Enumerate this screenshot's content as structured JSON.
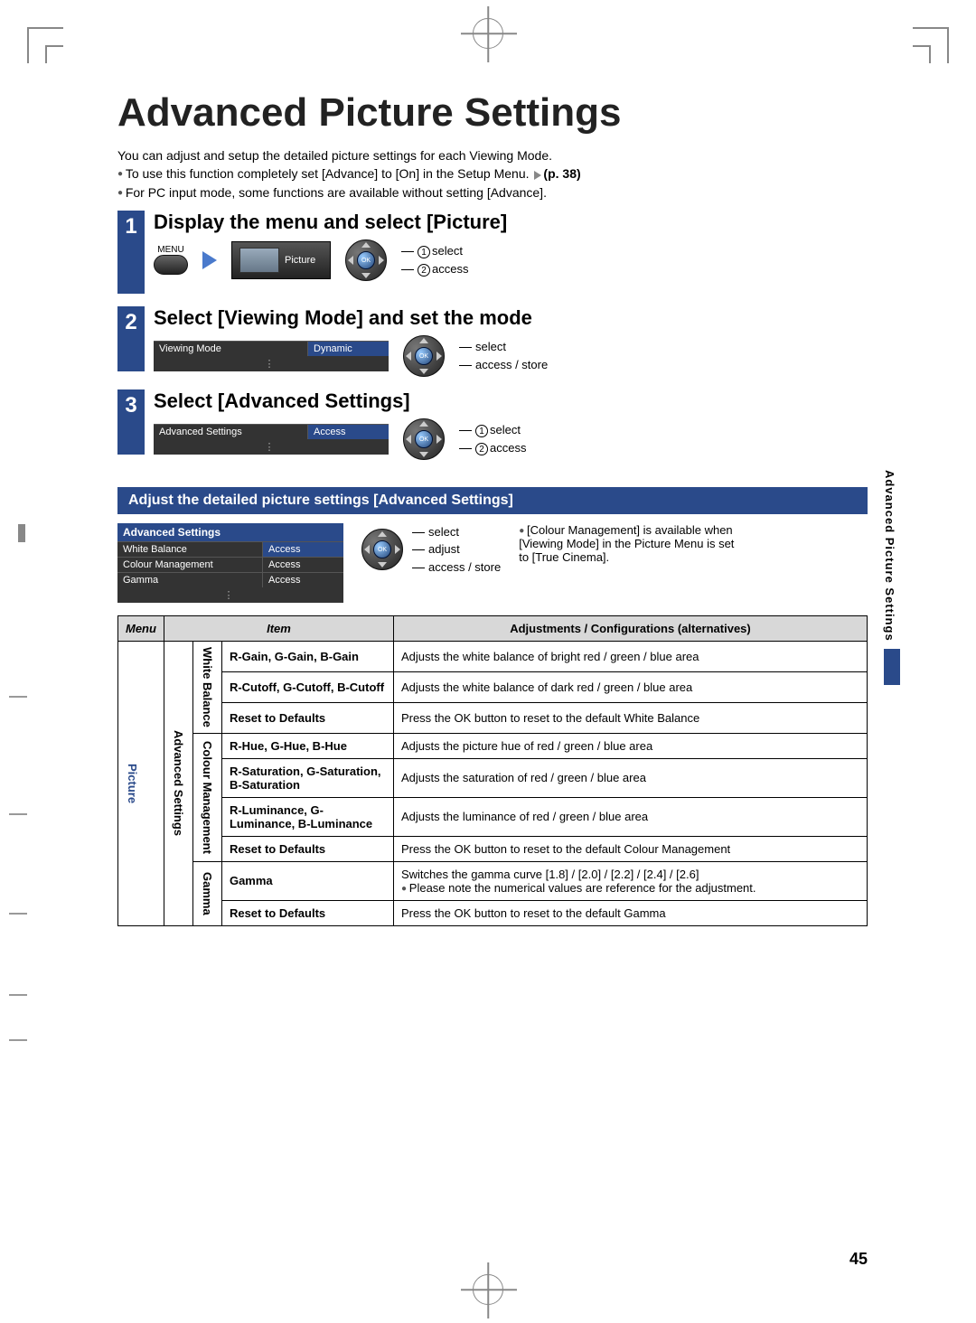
{
  "title": "Advanced Picture Settings",
  "intro_line": "You can adjust and setup the detailed picture settings for each Viewing Mode.",
  "intro_bullet1": "To use this function completely set [Advance] to [On] in the Setup Menu. ",
  "intro_pageref": "(p. 38)",
  "intro_bullet2": "For PC input mode, some functions are available without setting [Advance].",
  "step1": {
    "num": "1",
    "title": "Display the menu and select [Picture]",
    "menu_label": "MENU",
    "osd_picture": "Picture",
    "dpad_l1": "select",
    "dpad_l2": "access"
  },
  "step2": {
    "num": "2",
    "title": "Select [Viewing Mode] and set the mode",
    "row_label": "Viewing Mode",
    "row_value": "Dynamic",
    "dpad_l1": "select",
    "dpad_l2": "access / store"
  },
  "step3": {
    "num": "3",
    "title": "Select [Advanced Settings]",
    "row_label": "Advanced Settings",
    "row_value": "Access",
    "dpad_l1": "select",
    "dpad_l2": "access"
  },
  "sub_bar": "Adjust the detailed picture settings [Advanced Settings]",
  "adv_menu": {
    "header": "Advanced Settings",
    "rows": [
      {
        "label": "White Balance",
        "value": "Access"
      },
      {
        "label": "Colour Management",
        "value": "Access"
      },
      {
        "label": "Gamma",
        "value": "Access"
      }
    ]
  },
  "adv_dpad": {
    "l1": "select",
    "l2": "adjust",
    "l3": "access / store"
  },
  "side_note": "[Colour Management] is available when [Viewing Mode] in the Picture Menu is set to [True Cinema].",
  "table": {
    "head_menu": "Menu",
    "head_item": "Item",
    "head_adj": "Adjustments / Configurations (alternatives)",
    "menu_label": "Picture",
    "submenu_label": "Advanced Settings",
    "groups": [
      {
        "group": "White Balance",
        "rows": [
          {
            "item": "R-Gain, G-Gain, B-Gain",
            "desc": "Adjusts the white balance of bright red / green / blue area"
          },
          {
            "item": "R-Cutoff, G-Cutoff, B-Cutoff",
            "desc": "Adjusts the white balance of dark red / green / blue area"
          },
          {
            "item": "Reset to Defaults",
            "desc": "Press the OK button to reset to the default White Balance"
          }
        ]
      },
      {
        "group": "Colour Management",
        "rows": [
          {
            "item": "R-Hue, G-Hue, B-Hue",
            "desc": "Adjusts the picture hue of red / green / blue area"
          },
          {
            "item": "R-Saturation, G-Saturation, B-Saturation",
            "desc": "Adjusts the saturation of red / green / blue area"
          },
          {
            "item": "R-Luminance, G-Luminance, B-Luminance",
            "desc": "Adjusts the luminance of red / green / blue area"
          },
          {
            "item": "Reset to Defaults",
            "desc": "Press the OK button to reset to the default Colour Management"
          }
        ]
      },
      {
        "group": "Gamma",
        "rows": [
          {
            "item": "Gamma",
            "desc": "Switches the gamma curve [1.8] / [2.0] / [2.2] / [2.4] / [2.6]",
            "note": "Please note the numerical values are reference for the adjustment."
          },
          {
            "item": "Reset to Defaults",
            "desc": "Press the OK button to reset to the default Gamma"
          }
        ]
      }
    ]
  },
  "side_tab": "Advanced Picture Settings",
  "page_number": "45",
  "ok_label": "OK"
}
